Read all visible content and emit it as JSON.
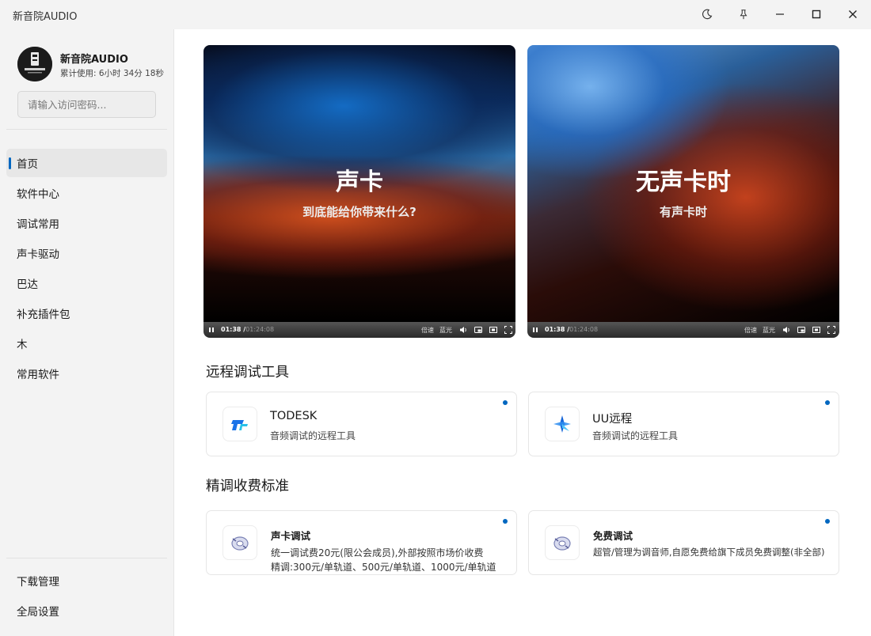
{
  "app": {
    "title": "新音院AUDIO"
  },
  "user": {
    "name": "新音院AUDIO",
    "usage": "累计使用: 6小时 34分 18秒",
    "password_placeholder": "请输入访问密码..."
  },
  "nav": {
    "items": [
      {
        "label": "首页",
        "active": true
      },
      {
        "label": "软件中心"
      },
      {
        "label": "调试常用"
      },
      {
        "label": "声卡驱动"
      },
      {
        "label": "巴达"
      },
      {
        "label": "补充插件包"
      },
      {
        "label": "木"
      },
      {
        "label": "常用软件"
      }
    ],
    "bottom": [
      {
        "label": "下载管理"
      },
      {
        "label": "全局设置"
      }
    ]
  },
  "videos": [
    {
      "title": "声卡",
      "subtitle": "到底能给你带来什么?",
      "current": "01:38 /",
      "total": "01:24:08",
      "speed": "倍速",
      "blue": "蓝光"
    },
    {
      "title": "无声卡时",
      "subtitle": "有声卡时",
      "current": "01:38 /",
      "total": "01:24:08",
      "speed": "倍速",
      "blue": "蓝光"
    }
  ],
  "remote": {
    "heading": "远程调试工具",
    "cards": [
      {
        "title": "TODESK",
        "desc": "音频调试的远程工具",
        "icon": "todesk-icon"
      },
      {
        "title": "UU远程",
        "desc": "音频调试的远程工具",
        "icon": "uu-remote-icon"
      }
    ]
  },
  "pricing": {
    "heading": "精调收费标准",
    "cards": [
      {
        "title": "声卡调试",
        "line1": "统一调试费20元(限公会成员),外部按照市场价收费",
        "line2": "精调:300元/单轨道、500元/单轨道、1000元/单轨道"
      },
      {
        "title": "免费调试",
        "line1": "超管/管理为调音师,自愿免费给旗下成员免费调整(非全部)"
      }
    ]
  },
  "colors": {
    "accent": "#0067c0",
    "sidebar": "#f3f3f3"
  }
}
